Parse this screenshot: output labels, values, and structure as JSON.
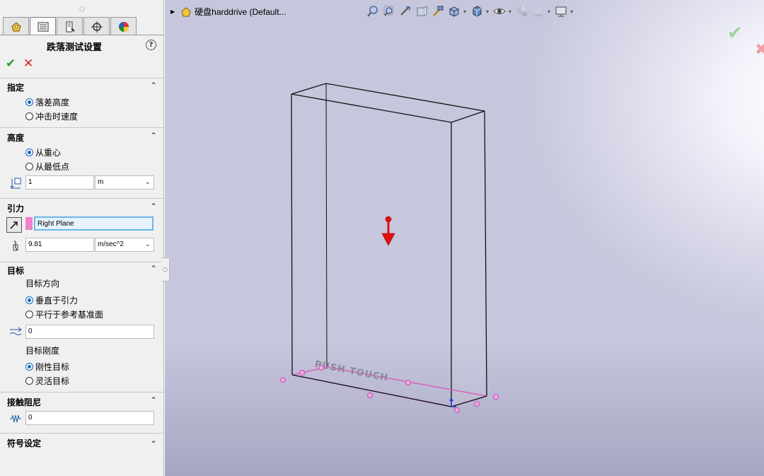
{
  "panel": {
    "title": "跌落测试设置",
    "help": "?",
    "ok": "✔",
    "cancel": "✕",
    "grip": "○",
    "sections": {
      "specify": {
        "title": "指定",
        "option1": "落差高度",
        "option2": "冲击时速度"
      },
      "height": {
        "title": "高度",
        "option1": "从重心",
        "option2": "从最低点",
        "value": "1",
        "unit": "m"
      },
      "gravity": {
        "title": "引力",
        "reference": "Right Plane",
        "value": "9.81",
        "unit": "m/sec^2"
      },
      "target": {
        "title": "目标",
        "direction_label": "目标方向",
        "dir_option1": "垂直于引力",
        "dir_option2": "平行于参考基准面",
        "offset": "0",
        "stiffness_label": "目标刚度",
        "stiff_option1": "刚性目标",
        "stiff_option2": "灵活目标"
      },
      "damping": {
        "title": "接触阻尼",
        "value": "0"
      },
      "symbol": {
        "title": "符号设定"
      }
    }
  },
  "viewport": {
    "tree_label": "硬盘harddrive  (Default...",
    "model_text": "PUSH TOUCH",
    "colors": {
      "arrow": "#e01010",
      "edge_highlight": "#e060c0",
      "handle": "#e070d0"
    }
  }
}
